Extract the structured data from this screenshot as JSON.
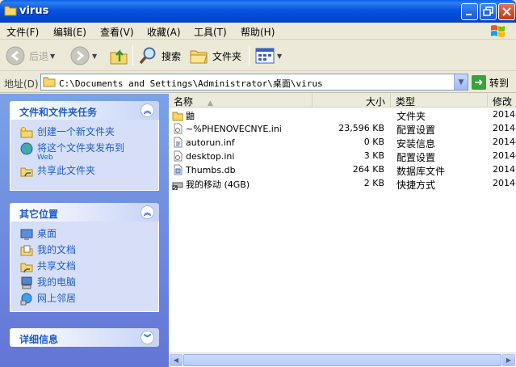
{
  "window": {
    "title": "virus"
  },
  "menu": [
    "文件(F)",
    "编辑(E)",
    "查看(V)",
    "收藏(A)",
    "工具(T)",
    "帮助(H)"
  ],
  "toolbar": {
    "back": "后退",
    "search": "搜索",
    "folders": "文件夹"
  },
  "address": {
    "label": "地址(D)",
    "path": "C:\\Documents and Settings\\Administrator\\桌面\\virus",
    "go": "转到"
  },
  "tasks_panel": {
    "title": "文件和文件夹任务",
    "items": [
      {
        "label": "创建一个新文件夹",
        "sub": ""
      },
      {
        "label": "将这个文件夹发布到",
        "sub": "Web"
      },
      {
        "label": "共享此文件夹",
        "sub": ""
      }
    ]
  },
  "places_panel": {
    "title": "其它位置",
    "items": [
      "桌面",
      "我的文档",
      "共享文档",
      "我的电脑",
      "网上邻居"
    ]
  },
  "details_panel": {
    "title": "详细信息"
  },
  "columns": {
    "name": "名称",
    "size": "大小",
    "type": "类型",
    "date": "修改"
  },
  "files": [
    {
      "name": "鼬",
      "size": "",
      "type": "文件夹",
      "date": "2014-",
      "icon": "folder-icon"
    },
    {
      "name": "~%PHENOVECNYE.ini",
      "size": "23,596 KB",
      "type": "配置设置",
      "date": "2014-",
      "icon": "ini-file-icon"
    },
    {
      "name": "autorun.inf",
      "size": "0 KB",
      "type": "安装信息",
      "date": "2014-",
      "icon": "inf-file-icon"
    },
    {
      "name": "desktop.ini",
      "size": "3 KB",
      "type": "配置设置",
      "date": "2014-",
      "icon": "ini-file-icon"
    },
    {
      "name": "Thumbs.db",
      "size": "264 KB",
      "type": "数据库文件",
      "date": "2014-",
      "icon": "db-file-icon"
    },
    {
      "name": "我的移动 (4GB)",
      "size": "2 KB",
      "type": "快捷方式",
      "date": "2014-",
      "icon": "shortcut-drive-icon"
    }
  ]
}
